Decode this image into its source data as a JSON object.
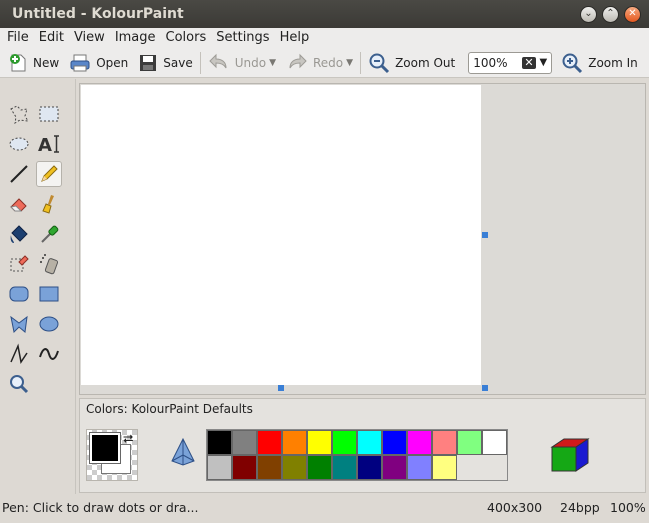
{
  "window": {
    "title": "Untitled - KolourPaint"
  },
  "menu": [
    "File",
    "Edit",
    "View",
    "Image",
    "Colors",
    "Settings",
    "Help"
  ],
  "toolbar": {
    "new": "New",
    "open": "Open",
    "save": "Save",
    "undo": "Undo",
    "redo": "Redo",
    "zoom_out": "Zoom Out",
    "zoom_value": "100%",
    "zoom_in": "Zoom In"
  },
  "tools": [
    "free-form-selection",
    "rectangular-selection",
    "elliptical-selection",
    "text",
    "line",
    "pen",
    "eraser",
    "brush",
    "flood-fill",
    "color-picker",
    "color-eraser",
    "spraycan",
    "rounded-rectangle",
    "rectangle",
    "polygon",
    "ellipse",
    "connected-lines",
    "curve",
    "zoom"
  ],
  "selected_tool": "pen",
  "colors": {
    "label": "Colors: KolourPaint Defaults",
    "foreground": "#000000",
    "background": "#ffffff",
    "row1": [
      "#000000",
      "#808080",
      "#ff0000",
      "#ff8000",
      "#ffff00",
      "#00ff00",
      "#00ffff",
      "#0000ff",
      "#ff00ff",
      "#ff8080",
      "#80ff80"
    ],
    "row2": [
      "#ffffff",
      "#c0c0c0",
      "#800000",
      "#804000",
      "#808000",
      "#008000",
      "#008080",
      "#000080",
      "#800080",
      "#8080ff",
      "#ffff80"
    ]
  },
  "status": {
    "message": "Pen: Click to draw dots or dra...",
    "size": "400x300",
    "bpp": "24bpp",
    "zoom": "100%"
  }
}
